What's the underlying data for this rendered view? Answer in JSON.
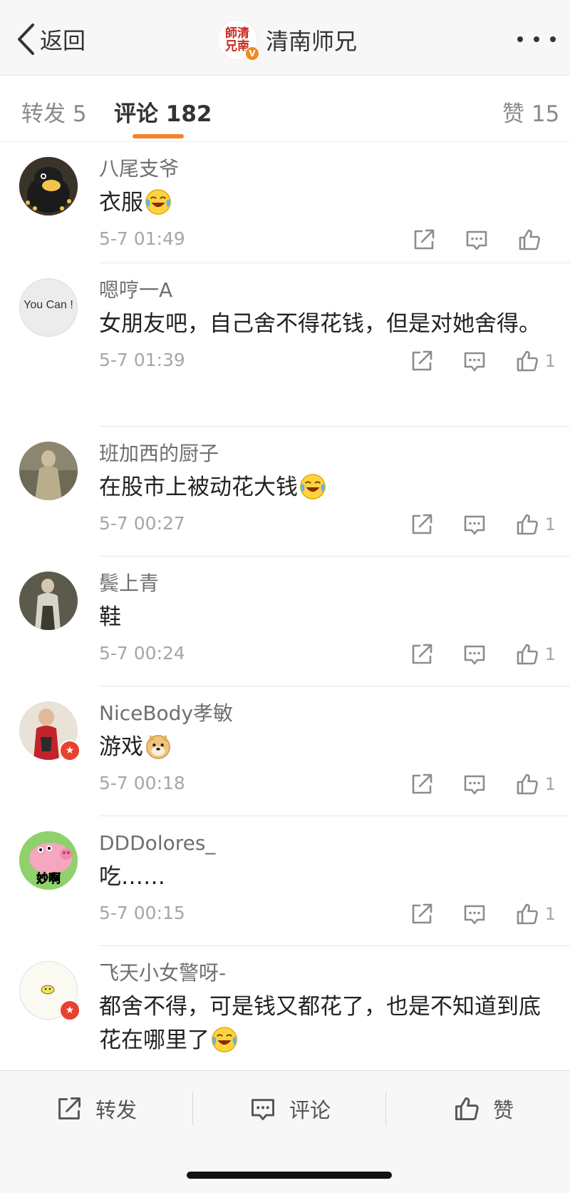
{
  "nav": {
    "back_label": "返回",
    "account_name": "清南师兄",
    "avatar_seal_text": "師清兄南",
    "verified_badge": "V"
  },
  "tabs": [
    {
      "label": "转发",
      "count": "5"
    },
    {
      "label": "评论",
      "count": "182",
      "active": true
    },
    {
      "label": "赞",
      "count": "15"
    }
  ],
  "comments": [
    {
      "user": "八尾支爷",
      "text": "衣服",
      "emoji": "laugh-cry",
      "time": "5-7 01:49",
      "likes": ""
    },
    {
      "user": "嗯哼一A",
      "text": "女朋友吧，自己舍不得花钱，但是对她舍得。",
      "time": "5-7 01:39",
      "likes": "1",
      "avatar_text": "You Can !"
    },
    {
      "user": "班加西的厨子",
      "text": "在股市上被动花大钱",
      "emoji": "laugh-cry",
      "time": "5-7 00:27",
      "likes": "1"
    },
    {
      "user": "鬓上青",
      "text": "鞋",
      "time": "5-7 00:24",
      "likes": "1"
    },
    {
      "user": "NiceBody孝敏",
      "text": "游戏",
      "emoji": "doge",
      "time": "5-7 00:18",
      "likes": "1",
      "badge": true
    },
    {
      "user": "DDDolores_",
      "text": "吃……",
      "time": "5-7 00:15",
      "likes": "1",
      "avatar_text": "妙啊"
    },
    {
      "user": "飞天小女警呀-",
      "text": "都舍不得，可是钱又都花了，也是不知道到底花在哪里了",
      "emoji": "laugh-cry",
      "badge": true
    }
  ],
  "toolbar": {
    "repost_label": "转发",
    "comment_label": "评论",
    "like_label": "赞"
  },
  "colors": {
    "accent": "#f5822a",
    "badge_red": "#e8412f",
    "verified_orange": "#f08a1c"
  }
}
